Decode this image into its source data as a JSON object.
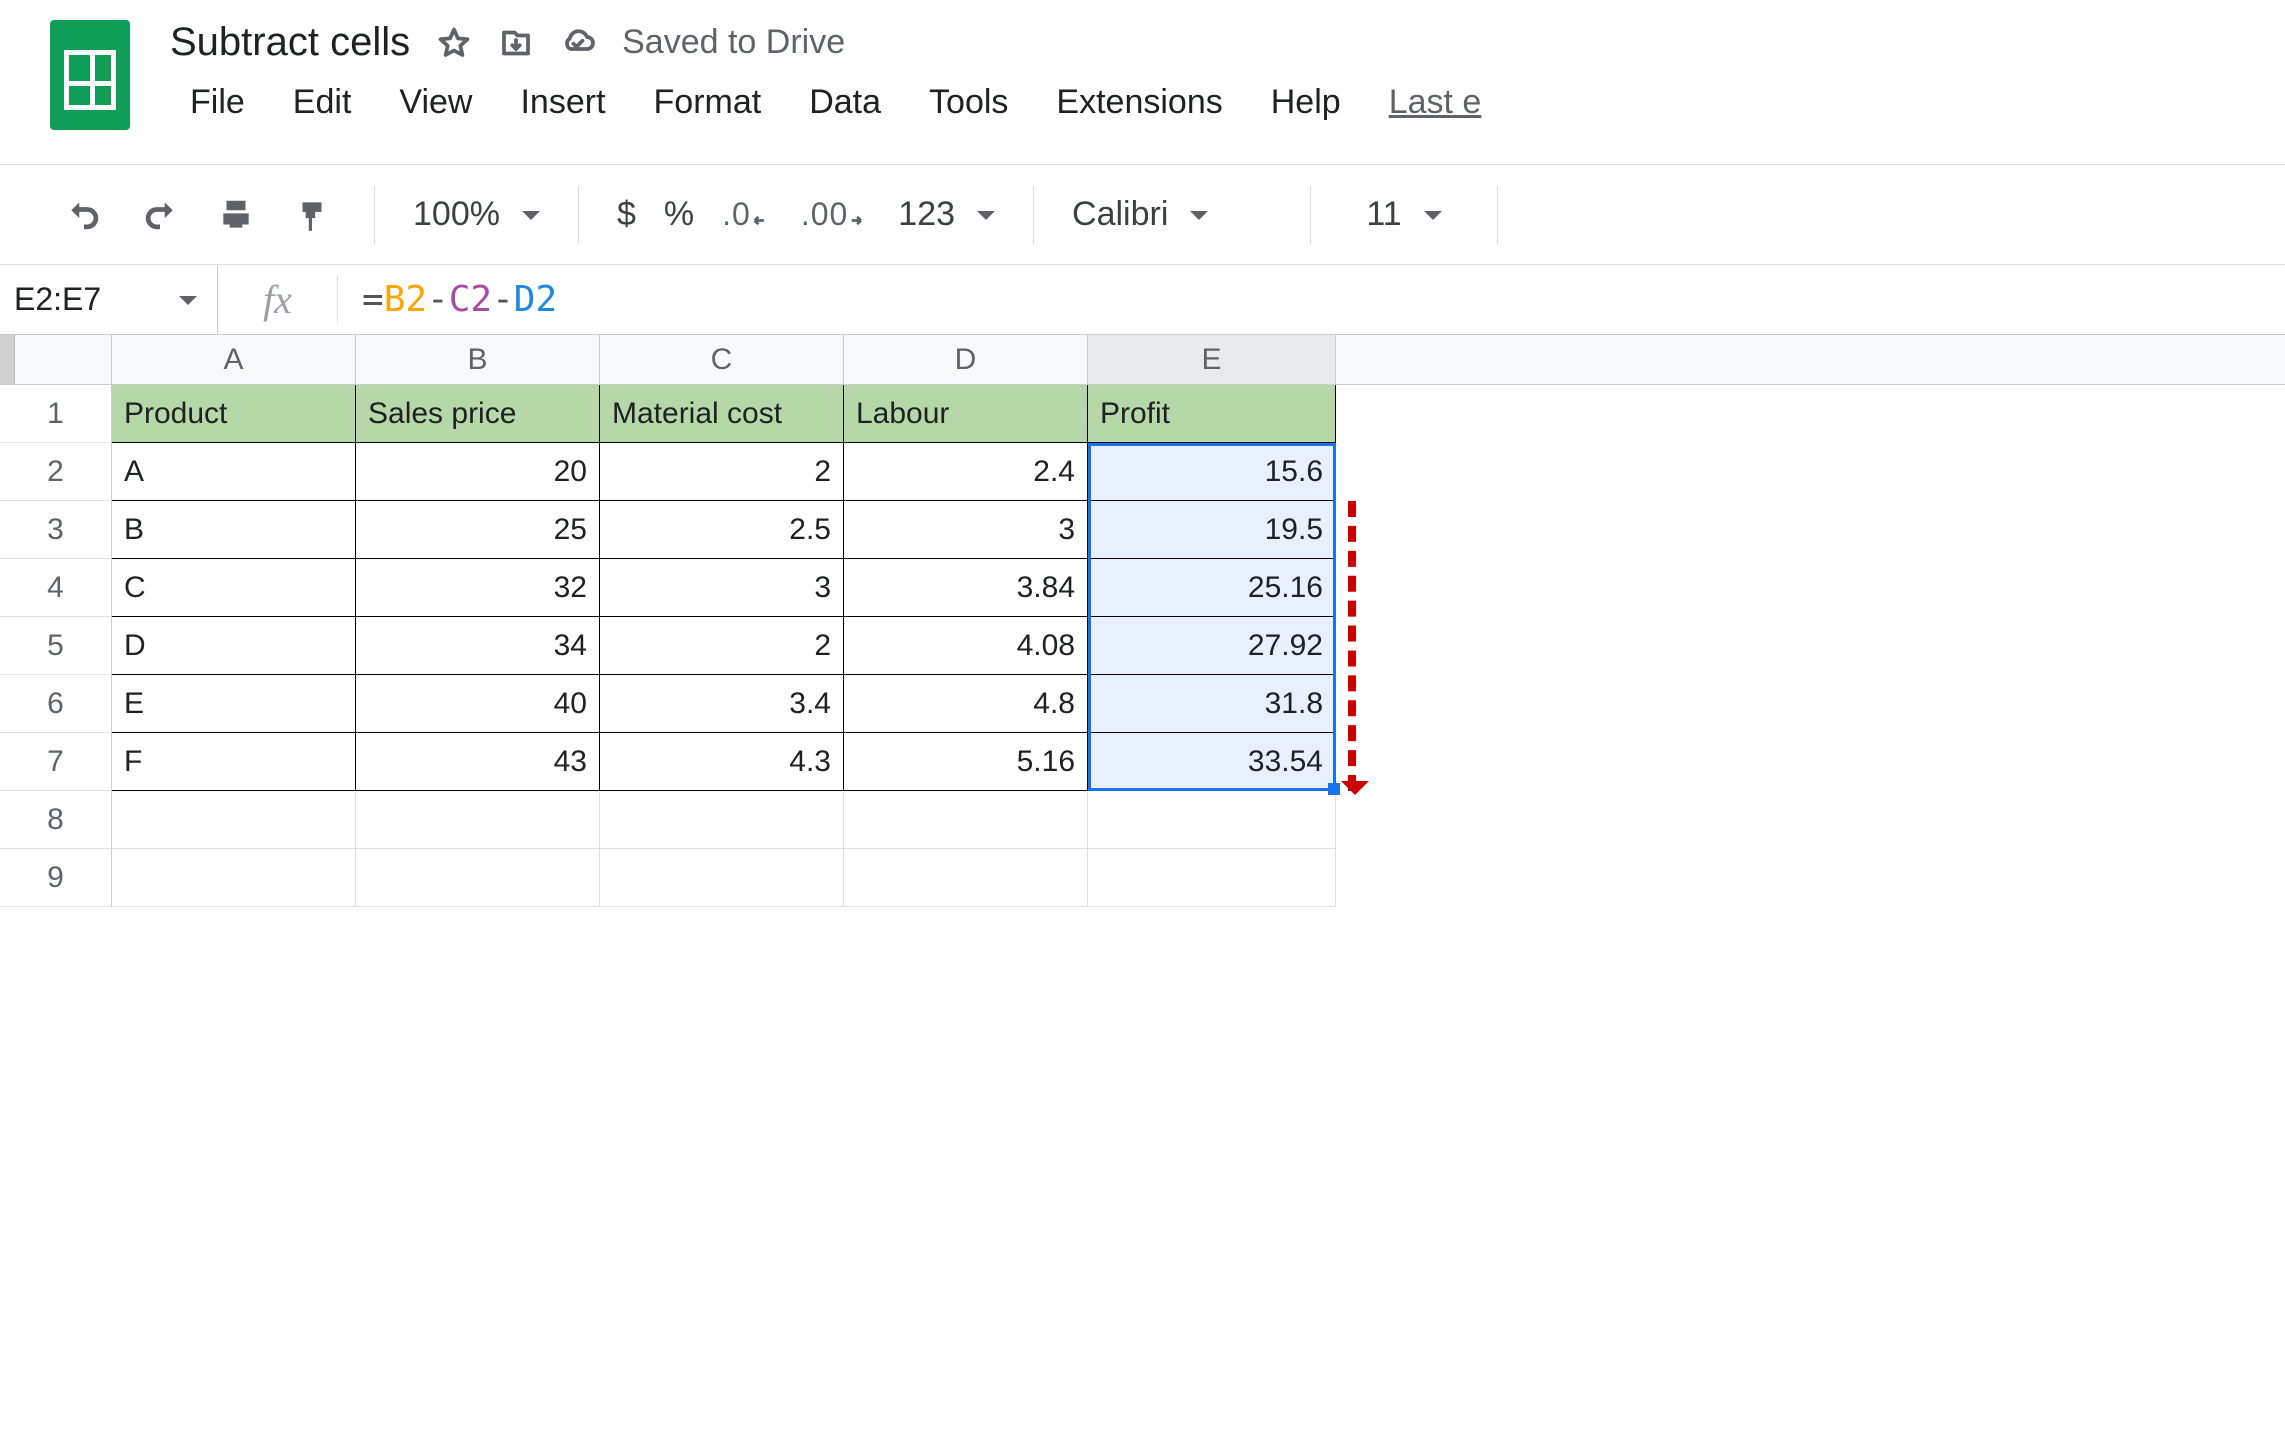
{
  "doc": {
    "name": "Subtract cells",
    "save_status": "Saved to Drive"
  },
  "menus": [
    "File",
    "Edit",
    "View",
    "Insert",
    "Format",
    "Data",
    "Tools",
    "Extensions",
    "Help"
  ],
  "last_edit": "Last e",
  "toolbar": {
    "zoom": "100%",
    "format_num": "123",
    "font": "Calibri",
    "font_size": "11",
    "currency": "$",
    "percent": "%",
    "dec_dec": ".0",
    "inc_dec": ".00"
  },
  "namebox": "E2:E7",
  "formula": {
    "eq": "=",
    "r1": "B2",
    "m1": "-",
    "r2": "C2",
    "m2": "-",
    "r3": "D2"
  },
  "columns": [
    "A",
    "B",
    "C",
    "D",
    "E"
  ],
  "headers": [
    "Product",
    "Sales price",
    "Material cost",
    "Labour",
    "Profit"
  ],
  "rows": [
    {
      "p": "A",
      "s": "20",
      "m": "2",
      "l": "2.4",
      "pr": "15.6"
    },
    {
      "p": "B",
      "s": "25",
      "m": "2.5",
      "l": "3",
      "pr": "19.5"
    },
    {
      "p": "C",
      "s": "32",
      "m": "3",
      "l": "3.84",
      "pr": "25.16"
    },
    {
      "p": "D",
      "s": "34",
      "m": "2",
      "l": "4.08",
      "pr": "27.92"
    },
    {
      "p": "E",
      "s": "40",
      "m": "3.4",
      "l": "4.8",
      "pr": "31.8"
    },
    {
      "p": "F",
      "s": "43",
      "m": "4.3",
      "l": "5.16",
      "pr": "33.54"
    }
  ],
  "row_numbers": [
    "1",
    "2",
    "3",
    "4",
    "5",
    "6",
    "7",
    "8",
    "9"
  ]
}
